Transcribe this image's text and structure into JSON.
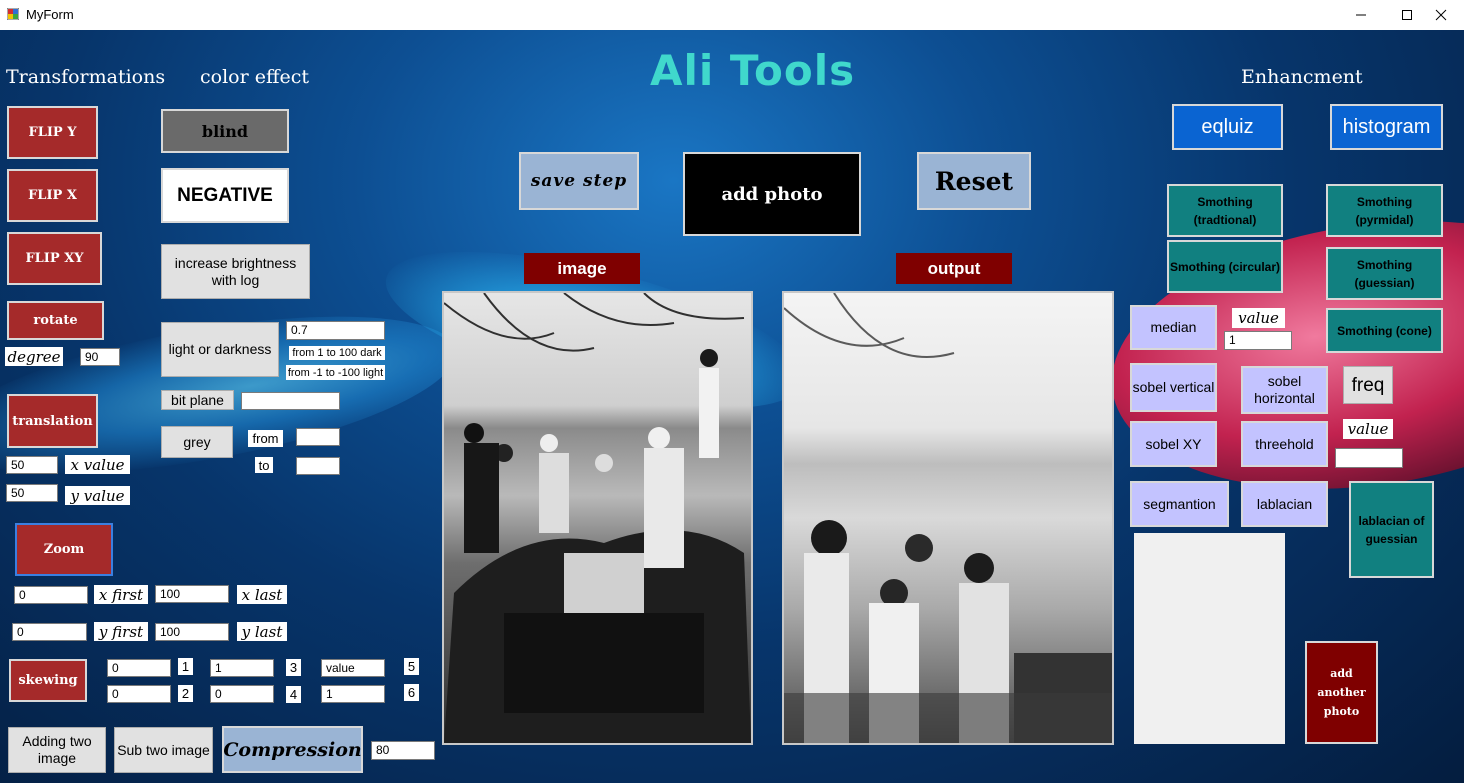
{
  "window": {
    "title": "MyForm"
  },
  "app": {
    "title": "Ali Tools"
  },
  "sections": {
    "transformations": "Transformations",
    "color_effect": "color effect",
    "enhancement": "Enhancment"
  },
  "transform": {
    "flip_y": "FLIP Y",
    "flip_x": "FLIP X",
    "flip_xy": "FLIP XY",
    "rotate": "rotate",
    "degree_label": "degree",
    "degree_value": "90",
    "translation": "translation",
    "x_value_input": "50",
    "x_value_label": "x value",
    "y_value_input": "50",
    "y_value_label": "y value",
    "zoom": "Zoom",
    "x_first_input": "0",
    "x_first_label": "x first",
    "x_last_input": "100",
    "x_last_label": "x last",
    "y_first_input": "0",
    "y_first_label": "y first",
    "y_last_input": "100",
    "y_last_label": "y last",
    "skewing": "skewing",
    "skew": [
      {
        "value": "0",
        "num": "1"
      },
      {
        "value": "0",
        "num": "2"
      },
      {
        "value": "1",
        "num": "3"
      },
      {
        "value": "0",
        "num": "4"
      },
      {
        "value": "value",
        "num": "5"
      },
      {
        "value": "1",
        "num": "6"
      }
    ],
    "adding_two": "Adding two image",
    "sub_two": "Sub two image",
    "compression": "Compression",
    "compression_value": "80"
  },
  "color": {
    "blind": "blind",
    "negative": "NEGATIVE",
    "increase_brightness": "increase brightness with log",
    "light_dark": "light or darkness",
    "light_value": "0.7",
    "dark_hint": "from 1 to 100 dark",
    "light_hint": "from -1 to -100 light",
    "bit_plane": "bit plane",
    "bit_plane_value": "",
    "grey": "grey",
    "from": "from",
    "to": "to",
    "from_value": "",
    "to_value": ""
  },
  "center": {
    "save_step": "save step",
    "add_photo": "add photo",
    "reset": "Reset",
    "image_label": "image",
    "output_label": "output"
  },
  "enhance": {
    "equalize": "eqluiz",
    "histogram": "histogram",
    "smoothing_traditional": "Smothing (tradtional)",
    "smoothing_pyramidal": "Smothing (pyrmidal)",
    "smoothing_circular": "Smothing (circular)",
    "smoothing_gaussian": "Smothing (guessian)",
    "smoothing_cone": "Smothing (cone)",
    "median": "median",
    "value_label": "value",
    "value_input": "1",
    "sobel_vertical": "sobel vertical",
    "sobel_horizontal": "sobel horizontal",
    "freq": "freq",
    "value_label2": "value",
    "freq_value": "",
    "sobel_xy": "sobel XY",
    "threshold": "threehold",
    "segmentation": "segmantion",
    "laplacian": "lablacian",
    "laplacian_gaussian": "lablacian of guessian",
    "add_another_photo": "add another photo"
  }
}
